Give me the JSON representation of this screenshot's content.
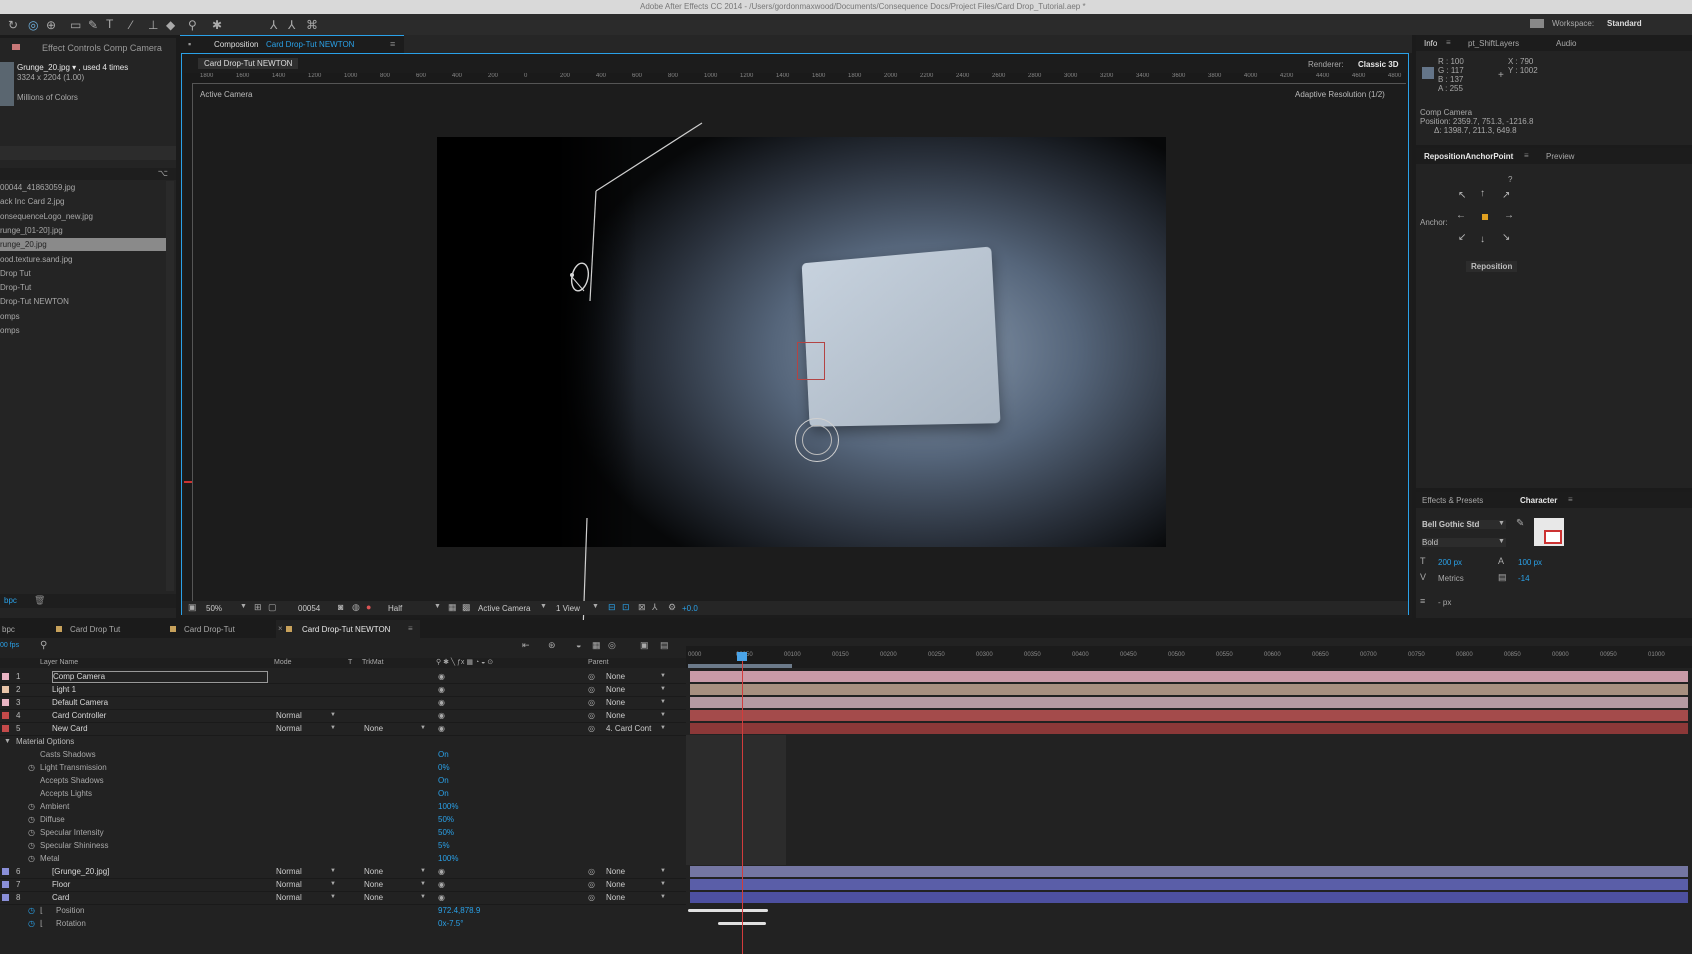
{
  "app": {
    "title": "Adobe After Effects CC 2014 - /Users/gordonmaxwood/Documents/Consequence Docs/Project Files/Card Drop_Tutorial.aep *",
    "workspace_label": "Workspace:",
    "workspace_value": "Standard"
  },
  "project": {
    "effect_controls_tab": "Effect Controls Comp Camera",
    "file_name": "Grunge_20.jpg ▾ , used 4 times",
    "file_dims": "3324 x 2204 (1.00)",
    "file_colors": "Millions of Colors",
    "items": [
      "00044_41863059.jpg",
      "ack Inc Card 2.jpg",
      "onsequenceLogo_new.jpg",
      "runge_[01-20].jpg",
      "runge_20.jpg",
      "ood.texture.sand.jpg",
      "Drop Tut",
      "Drop-Tut",
      "Drop-Tut NEWTON",
      "omps",
      "omps"
    ],
    "selected_index": 4,
    "bpc": "bpc"
  },
  "composition": {
    "panel_tab_prefix": "Composition",
    "panel_tab_name": "Card Drop-Tut NEWTON",
    "subtab": "Card Drop-Tut NEWTON",
    "renderer_label": "Renderer:",
    "renderer_value": "Classic 3D",
    "view_label": "Active Camera",
    "resolution_label": "Adaptive Resolution (1/2)",
    "ruler_labels": [
      "1800",
      "1600",
      "1400",
      "1200",
      "1000",
      "800",
      "600",
      "400",
      "200",
      "0",
      "200",
      "400",
      "600",
      "800",
      "1000",
      "1200",
      "1400",
      "1600",
      "1800",
      "2000",
      "2200",
      "2400",
      "2600",
      "2800",
      "3000",
      "3200",
      "3400",
      "3600",
      "3800",
      "4000",
      "4200",
      "4400",
      "4600",
      "4800",
      "5000"
    ],
    "footer": {
      "zoom": "50%",
      "timecode": "00054",
      "resolution": "Half",
      "camera": "Active Camera",
      "views": "1 View",
      "exposure": "+0.0"
    }
  },
  "info": {
    "tabs": [
      "Info",
      "pt_ShiftLayers",
      "Audio"
    ],
    "r": "R : 100",
    "g": "G : 117",
    "b": "B : 137",
    "a": "A : 255",
    "x": "X : 790",
    "y": "Y : 1002",
    "layer": "Comp Camera",
    "position": "Position: 2359.7, 751.3, -1216.8",
    "delta": "Δ: 1398.7, 211.3, 649.8",
    "swatch": "#647589"
  },
  "reposition": {
    "tabs": [
      "RepositionAnchorPoint",
      "Preview"
    ],
    "question": "?",
    "anchor_label": "Anchor:",
    "button": "Reposition"
  },
  "character": {
    "tabs": [
      "Effects & Presets",
      "Character"
    ],
    "font": "Bell Gothic Std",
    "style": "Bold",
    "size": "200 px",
    "leading": "100 px",
    "kerning": "Metrics",
    "tracking": "-14",
    "stroke": "- px"
  },
  "timeline": {
    "tabs": [
      "Card Drop Tut",
      "Card Drop-Tut",
      "Card Drop-Tut NEWTON"
    ],
    "left_tab": "bpc",
    "fps": "00 fps",
    "col_headers": {
      "name": "Layer Name",
      "mode": "Mode",
      "t": "T",
      "trkmat": "TrkMat",
      "parent": "Parent"
    },
    "ruler": [
      "0000",
      "00050",
      "00100",
      "00150",
      "00200",
      "00250",
      "00300",
      "00350",
      "00400",
      "00450",
      "00500",
      "00550",
      "00600",
      "00650",
      "00700",
      "00750",
      "00800",
      "00850",
      "00900",
      "00950",
      "01000",
      "0105"
    ],
    "layers": [
      {
        "num": "1",
        "name": "Comp Camera",
        "mode": "",
        "trkmat": "",
        "parent": "None",
        "color": "#e9b5c4",
        "bar": "#c99aa7"
      },
      {
        "num": "2",
        "name": "Light 1",
        "mode": "",
        "trkmat": "",
        "parent": "None",
        "color": "#e8c4a8",
        "bar": "#a89080"
      },
      {
        "num": "3",
        "name": "Default Camera",
        "mode": "",
        "trkmat": "",
        "parent": "None",
        "color": "#e9b5c4",
        "bar": "#b59aa2"
      },
      {
        "num": "4",
        "name": "Card Controller",
        "mode": "Normal",
        "trkmat": "",
        "parent": "None",
        "color": "#c44a4a",
        "bar": "#a44b4b"
      },
      {
        "num": "5",
        "name": "New Card",
        "mode": "Normal",
        "trkmat": "None",
        "parent": "4. Card Cont",
        "color": "#c44a4a",
        "bar": "#8c3838"
      }
    ],
    "material_group": "Material Options",
    "material": [
      {
        "name": "Casts Shadows",
        "value": "On"
      },
      {
        "name": "Light Transmission",
        "value": "0%"
      },
      {
        "name": "Accepts Shadows",
        "value": "On"
      },
      {
        "name": "Accepts Lights",
        "value": "On"
      },
      {
        "name": "Ambient",
        "value": "100%"
      },
      {
        "name": "Diffuse",
        "value": "50%"
      },
      {
        "name": "Specular Intensity",
        "value": "50%"
      },
      {
        "name": "Specular Shininess",
        "value": "5%"
      },
      {
        "name": "Metal",
        "value": "100%"
      }
    ],
    "layers2": [
      {
        "num": "6",
        "name": "[Grunge_20.jpg]",
        "mode": "Normal",
        "trkmat": "None",
        "parent": "None",
        "color": "#8a8fd8",
        "bar": "#7476a2"
      },
      {
        "num": "7",
        "name": "Floor",
        "mode": "Normal",
        "trkmat": "None",
        "parent": "None",
        "color": "#8a8fd8",
        "bar": "#5a5ea8"
      },
      {
        "num": "8",
        "name": "Card",
        "mode": "Normal",
        "trkmat": "None",
        "parent": "None",
        "color": "#8a8fd8",
        "bar": "#4d50a0"
      }
    ],
    "transform": [
      {
        "name": "Position",
        "value": "972.4,878.9"
      },
      {
        "name": "Rotation",
        "value": "0x-7.5°"
      }
    ]
  }
}
